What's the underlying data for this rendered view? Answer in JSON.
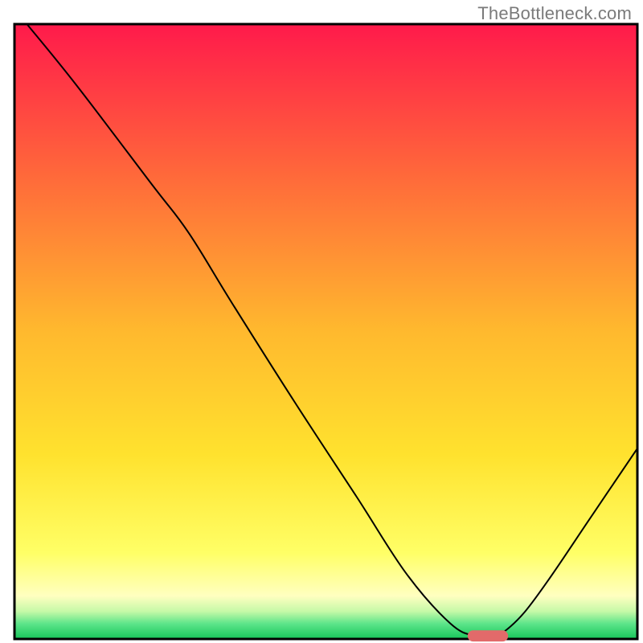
{
  "watermark": "TheBottleneck.com",
  "chart_data": {
    "type": "line",
    "title": "",
    "xlabel": "",
    "ylabel": "",
    "xlim": [
      0,
      100
    ],
    "ylim": [
      0,
      100
    ],
    "axes_visible": false,
    "legend": false,
    "background_gradient_stops": [
      {
        "offset": 0.0,
        "color": "#ff1a4b"
      },
      {
        "offset": 0.25,
        "color": "#ff6a3a"
      },
      {
        "offset": 0.5,
        "color": "#ffb92e"
      },
      {
        "offset": 0.7,
        "color": "#ffe22e"
      },
      {
        "offset": 0.86,
        "color": "#ffff66"
      },
      {
        "offset": 0.93,
        "color": "#ffffc0"
      },
      {
        "offset": 0.955,
        "color": "#c6f9a8"
      },
      {
        "offset": 0.975,
        "color": "#5de58a"
      },
      {
        "offset": 1.0,
        "color": "#17c55a"
      }
    ],
    "series": [
      {
        "name": "bottleneck-curve",
        "color": "#000000",
        "stroke_width": 2,
        "x": [
          2.0,
          10.0,
          22.0,
          28.0,
          35.0,
          45.0,
          55.0,
          63.0,
          70.0,
          74.0,
          77.0,
          79.0,
          82.0,
          86.0,
          92.0,
          100.0
        ],
        "values": [
          100.0,
          90.0,
          74.0,
          66.0,
          54.5,
          38.5,
          23.0,
          10.5,
          2.5,
          0.5,
          0.5,
          1.5,
          4.5,
          10.0,
          19.0,
          31.0
        ]
      }
    ],
    "markers": [
      {
        "name": "optimum-marker",
        "shape": "rounded-rect",
        "x_center": 76.0,
        "y_center": 0.5,
        "width": 6.5,
        "height": 1.8,
        "color": "#e26a6a"
      }
    ],
    "notes": "x and y are in 0–100 percent of the plot's inner area (left/bottom origin). The curve descends steeply from top-left, flattens near x≈74–78 at y≈0, then rises toward the right. The pink rounded tablet marks the minimum."
  }
}
